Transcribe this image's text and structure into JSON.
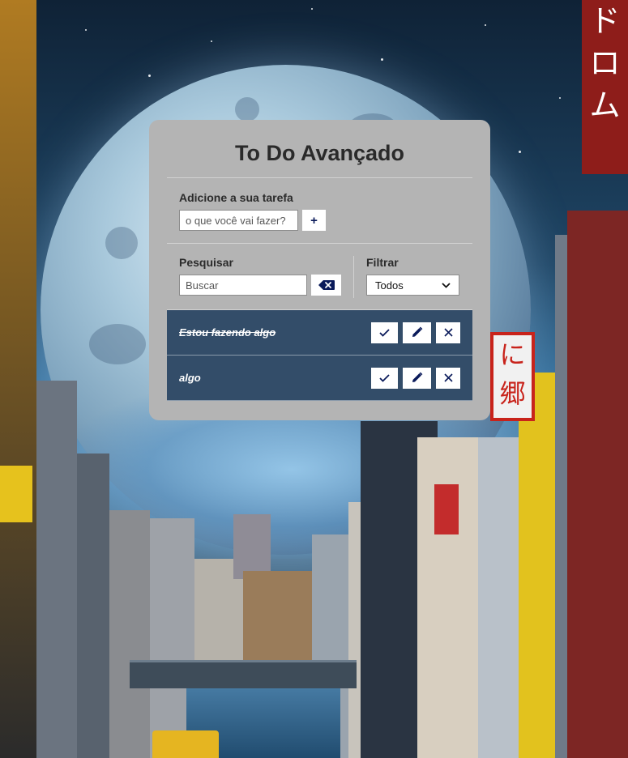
{
  "app": {
    "title": "To Do Avançado"
  },
  "add_form": {
    "label": "Adicione a sua tarefa",
    "input_placeholder": "o que você vai fazer?",
    "input_value": "",
    "add_button_label": "+"
  },
  "search": {
    "label": "Pesquisar",
    "input_placeholder": "Buscar",
    "input_value": "",
    "clear_icon": "backspace-icon"
  },
  "filter": {
    "label": "Filtrar",
    "selected": "Todos",
    "dropdown_icon": "chevron-down-icon"
  },
  "todos": [
    {
      "text": "Estou fazendo algo",
      "done": true
    },
    {
      "text": "algo",
      "done": false
    }
  ],
  "todo_actions": {
    "finish_icon": "check-icon",
    "edit_icon": "pencil-icon",
    "remove_icon": "close-icon"
  },
  "colors": {
    "card_background": "#b4b4b4",
    "todo_background": "#334d69",
    "icon_color": "#0a1a5a"
  }
}
